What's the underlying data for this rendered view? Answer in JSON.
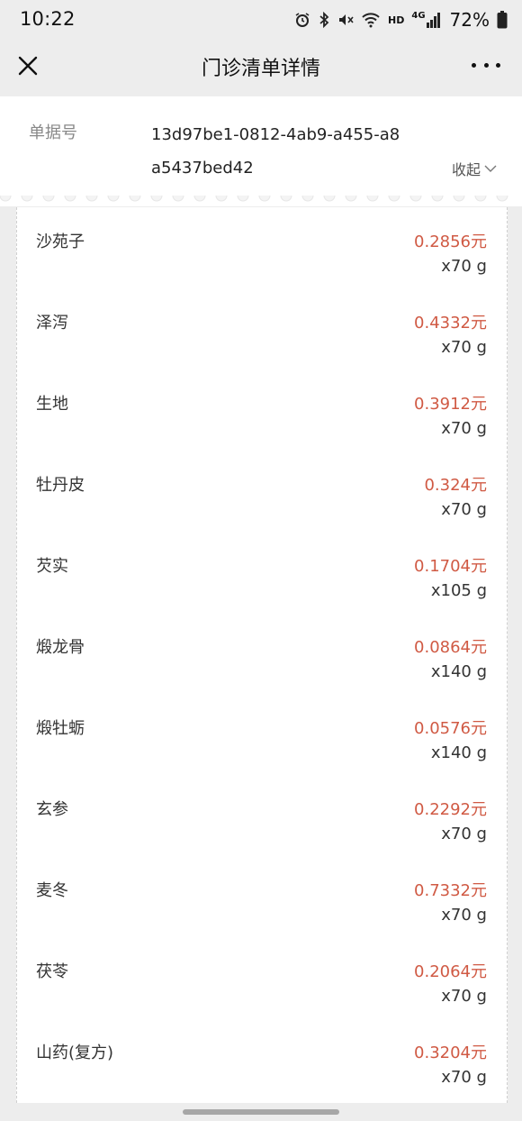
{
  "status_bar": {
    "time": "10:22",
    "battery_percent": "72%",
    "icons": [
      "alarm-icon",
      "bluetooth-icon",
      "mute-icon",
      "wifi-icon",
      "hd-icon",
      "signal-4g-icon",
      "battery-icon"
    ],
    "hd_label": "HD",
    "network_label": "4G"
  },
  "nav": {
    "title": "门诊清单详情"
  },
  "header": {
    "doc_label": "单据号",
    "doc_id": "13d97be1-0812-4ab9-a455-a8a5437bed42",
    "collapse_label": "收起"
  },
  "items": [
    {
      "name": "沙苑子",
      "price": "0.2856元",
      "qty": "x70  g"
    },
    {
      "name": "泽泻",
      "price": "0.4332元",
      "qty": "x70  g"
    },
    {
      "name": "生地",
      "price": "0.3912元",
      "qty": "x70  g"
    },
    {
      "name": "牡丹皮",
      "price": "0.324元",
      "qty": "x70  g"
    },
    {
      "name": "芡实",
      "price": "0.1704元",
      "qty": "x105  g"
    },
    {
      "name": "煅龙骨",
      "price": "0.0864元",
      "qty": "x140  g"
    },
    {
      "name": "煅牡蛎",
      "price": "0.0576元",
      "qty": "x140  g"
    },
    {
      "name": "玄参",
      "price": "0.2292元",
      "qty": "x70  g"
    },
    {
      "name": "麦冬",
      "price": "0.7332元",
      "qty": "x70  g"
    },
    {
      "name": "茯苓",
      "price": "0.2064元",
      "qty": "x70  g"
    },
    {
      "name": "山药(复方)",
      "price": "0.3204元",
      "qty": "x70  g"
    }
  ],
  "colors": {
    "price": "#d05a44",
    "background": "#ededed"
  }
}
